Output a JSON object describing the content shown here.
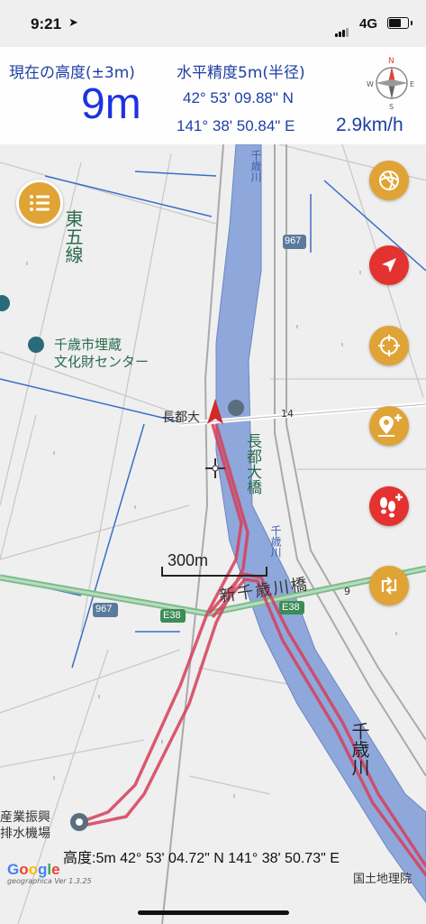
{
  "status_bar": {
    "time": "9:21",
    "network": "4G"
  },
  "header": {
    "altitude_label": "現在の高度(±3m)",
    "accuracy_label": "水平精度5m(半径)",
    "altitude_value": "9m",
    "latitude": "42° 53' 09.88\" N",
    "longitude": "141° 38' 50.84\" E",
    "speed": "2.9km/h"
  },
  "compass": {
    "north": "N",
    "south": "S",
    "east": "E",
    "west": "W"
  },
  "buttons": {
    "menu": "list-icon",
    "spiral": "spiral-icon",
    "current_location": "location-arrow-icon",
    "crosshair": "crosshair-icon",
    "add_pin": "add-pin-icon",
    "add_track": "footprints-plus-icon",
    "route": "route-switch-icon"
  },
  "map": {
    "labels": {
      "higashigo_line": "東五線",
      "museum": "千歳市埋蔵\n文化財センター",
      "osatsu_bridge_area": "長都大",
      "osatsu_bridge": "長都大橋",
      "river_top": "千歳川",
      "river_mid": "千歳川",
      "river_bottom": "千歳川",
      "new_bridge": "新千歳川橋",
      "drain_facility": "産業振興\n排水機場",
      "route_967_top": "967",
      "route_967_left": "967",
      "e38_left": "E38",
      "e38_right": "E38",
      "km_14": "14",
      "km_9": "9"
    },
    "scale": "300m"
  },
  "bottom": {
    "position_readout": "高度:5m  42° 53' 04.72\" N 141° 38' 50.73\" E",
    "attribution": "国土地理院",
    "google": "Google",
    "google_version": "geographica Ver 1.3.25"
  },
  "colors": {
    "header_text": "#1d3fa5",
    "altitude_text": "#1d33e0",
    "button_orange": "#e0a335",
    "button_red": "#e3322f",
    "track": "#d6405a",
    "river": "#8fa8dc"
  }
}
